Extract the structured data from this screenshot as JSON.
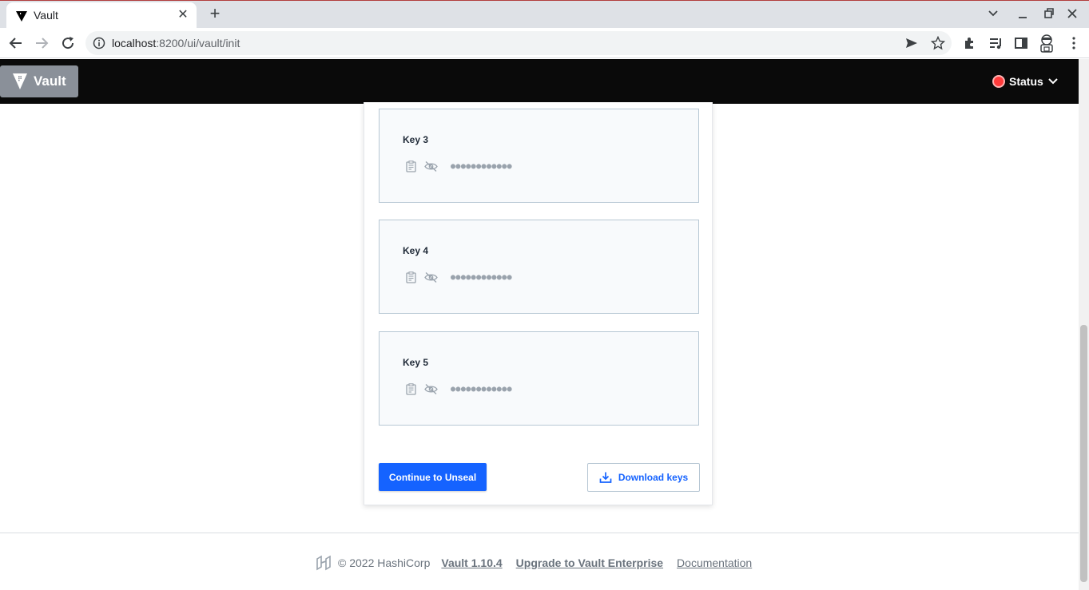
{
  "browser": {
    "tab_title": "Vault",
    "tab_close": "✕",
    "new_tab": "+",
    "url_host": "localhost",
    "url_path": ":8200/ui/vault/init",
    "window_controls": [
      "chevron-down",
      "minimize",
      "restore",
      "close"
    ]
  },
  "header": {
    "brand": "Vault",
    "status_label": "Status",
    "status_color": "#ff3b3b"
  },
  "keys": [
    {
      "label": "Key 3",
      "masked": "●●●●●●●●●●●●"
    },
    {
      "label": "Key 4",
      "masked": "●●●●●●●●●●●●"
    },
    {
      "label": "Key 5",
      "masked": "●●●●●●●●●●●●"
    }
  ],
  "actions": {
    "continue": "Continue to Unseal",
    "download": "Download keys"
  },
  "footer": {
    "copyright": "© 2022 HashiCorp",
    "version": "Vault 1.10.4",
    "upgrade": "Upgrade to Vault Enterprise",
    "docs": "Documentation"
  },
  "colors": {
    "accent": "#1563ff",
    "header_bg": "#0a0a0a"
  }
}
